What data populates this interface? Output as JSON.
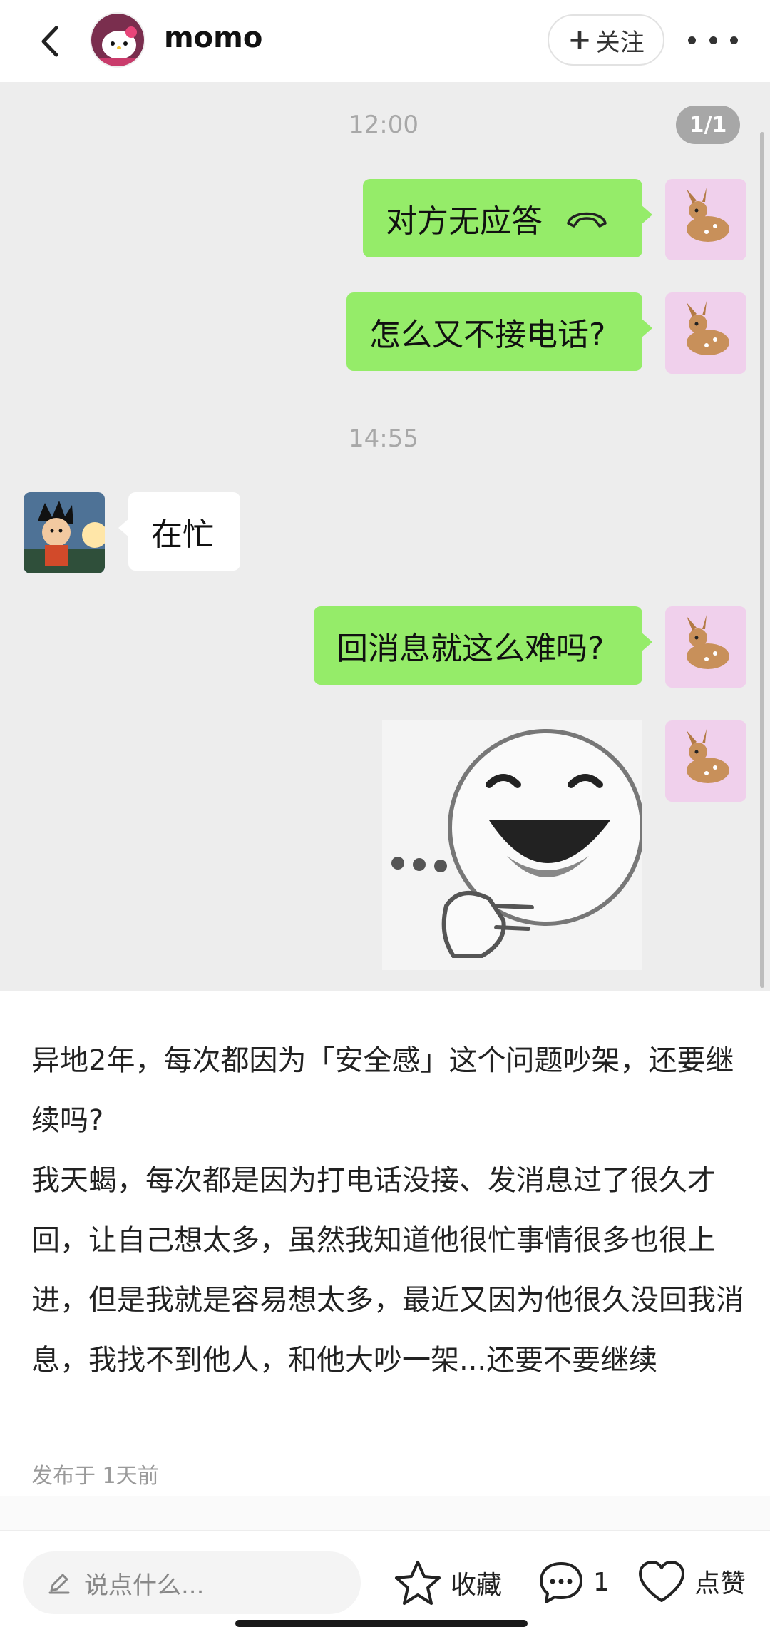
{
  "header": {
    "username": "momo",
    "follow_label": "关注"
  },
  "chat": {
    "page_indicator": "1/1",
    "messages": [
      {
        "type": "time",
        "text": "12:00"
      },
      {
        "type": "sent",
        "text": "对方无应答",
        "icon": "phone-hangup-icon"
      },
      {
        "type": "sent",
        "text": "怎么又不接电话?"
      },
      {
        "type": "time",
        "text": "14:55"
      },
      {
        "type": "received",
        "text": "在忙"
      },
      {
        "type": "sent",
        "text": "回消息就这么难吗?"
      },
      {
        "type": "sent-sticker",
        "sticker": "laughing-thumbs-up-sticker"
      }
    ]
  },
  "post": {
    "text_lines": [
      "异地2年，每次都因为「安全感」这个问题吵架，还要继续吗?",
      "我天蝎，每次都是因为打电话没接、发消息过了很久才回，让自己想太多，虽然我知道他很忙事情很多也很上进，但是我就是容易想太多，最近又因为他很久没回我消息，我找不到他人，和他大吵一架...还要不要继续"
    ],
    "published": "发布于 1天前"
  },
  "bottom_bar": {
    "comment_placeholder": "说点什么...",
    "favorite_label": "收藏",
    "comment_count": "1",
    "like_label": "点赞"
  }
}
